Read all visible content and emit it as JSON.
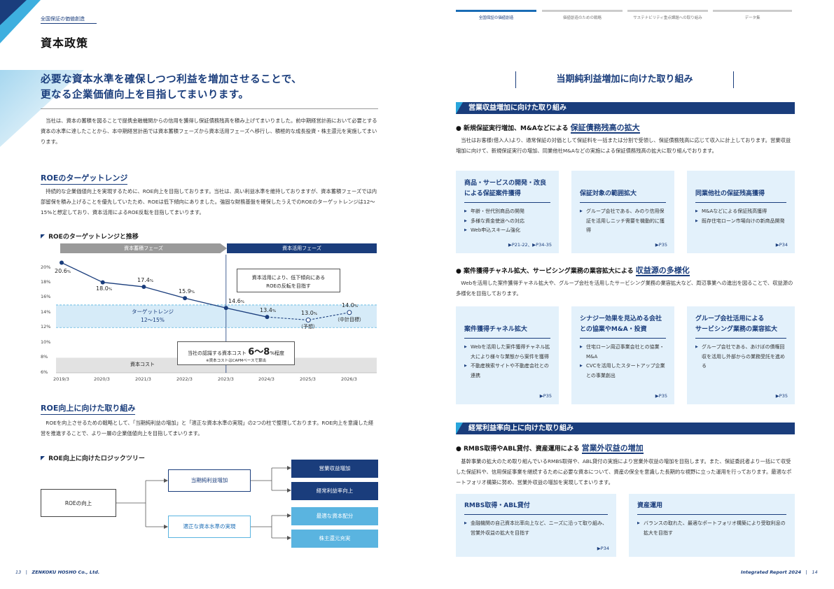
{
  "left": {
    "kicker": "全国保証の価値創造",
    "title": "資本政策",
    "lead_line1": "必要な資本水準を確保しつつ利益を増加させることで、",
    "lead_line2": "更なる企業価値向上を目指してまいります。",
    "intro": "当社は、資本の蓄積を図ることで提携金融機関からの信用を獲得し保証債務残高を積み上げてまいりました。前中期経営計画において必要とする資本の水準に達したことから、本中期経営計画では資本蓄積フェーズから資本活用フェーズへ移行し、積極的な成長投資・株主還元を実施してまいります。",
    "roe_section_title": "ROEのターゲットレンジ",
    "roe_section_text": "持続的な企業価値向上を実現するために、ROE向上を目指しております。当社は、高い利益水準を維持しておりますが、資本蓄積フェーズでは内部留保を積み上げることを優先していたため、ROEは低下傾向にありました。強固な財務基盤を確保したうえでのROEのターゲットレンジは12～15%と想定しており、資本活用によるROE反転を目指してまいります。",
    "chart_title": "ROEのターゲットレンジと推移",
    "improve_title": "ROE向上に向けた取り組み",
    "improve_text": "ROEを向上させるための戦略として、「当期純利益の増加」と「適正な資本水準の実現」の2つの柱で整理しております。ROE向上を意識した経営を推進することで、より一層の企業価値向上を目指してまいります。",
    "tree_title": "ROE向上に向けたロジックツリー",
    "tree": {
      "root": "ROEの向上",
      "branch1": "当期純利益増加",
      "branch2": "適正な資本水準の実現",
      "leaf1": "営業収益増加",
      "leaf2": "経常利益率向上",
      "leaf3": "最適な資本配分",
      "leaf4": "株主還元充実"
    },
    "footer_page": "13",
    "footer_brand": "ZENKOKU HOSHO Co., Ltd."
  },
  "chart_data": {
    "type": "line",
    "title": "ROEのターゲットレンジと推移",
    "categories": [
      "2019/3",
      "2020/3",
      "2021/3",
      "2022/3",
      "2023/3",
      "2024/3",
      "2025/3",
      "2026/3"
    ],
    "series": [
      {
        "values": [
          20.6,
          18.0,
          17.4,
          15.9,
          14.6,
          13.4,
          null,
          null
        ]
      },
      {
        "values": [
          null,
          null,
          null,
          null,
          null,
          13.4,
          13.0,
          14.0
        ]
      }
    ],
    "value_labels": [
      "20.6",
      "18.0",
      "17.4",
      "15.9",
      "14.6",
      "13.4",
      "13.0",
      "14.0"
    ],
    "unit": "%",
    "forecast_label": "（予想）",
    "target_label": "（中計目標）",
    "y_ticks": [
      "20%",
      "18%",
      "16%",
      "14%",
      "12%",
      "10%",
      "8%",
      "6%"
    ],
    "ylim": [
      6,
      20
    ],
    "phase1": "資本蓄積フェーズ",
    "phase2": "資本活用フェーズ",
    "target_range_label1": "ターゲットレンジ",
    "target_range_label2": "12～15%",
    "target_range": [
      12,
      15
    ],
    "cost_label": "資本コスト",
    "cost_range": [
      6,
      8
    ],
    "note_top1": "資本活用により、低下傾向にある",
    "note_top2": "ROEの反転を目指す",
    "note_cost_pre": "当社の認識する資本コスト",
    "note_cost_big": "6～8",
    "note_cost_post": "%程度",
    "note_cost_sub": "※資本コストはCAPMベースで算出"
  },
  "right": {
    "nav": [
      "全国保証の価値創造",
      "価値創造のための戦略",
      "サステナビリティ重点課題への取り組み",
      "データ集"
    ],
    "heading": "当期純利益増加に向けた取り組み",
    "band1": "営業収益増加に向けた取り組み",
    "b1_prefix": "新規保証実行増加、M&Aなどによる",
    "b1_hl": "保証債務残高の拡大",
    "b1_text": "当社はお客様(借入人)より、通常保証の対価として保証料を一括または分割で受領し、保証債務残高に応じて収入に計上しております。営業収益増加に向けて、新規保証実行の増加、同業他社M&Aなどの実施による保証債務残高の拡大に取り組んでおります。",
    "cards1": [
      {
        "h1": "商品・サービスの開発・改良",
        "h2": "による保証案件獲得",
        "items": [
          "年齢・世代別商品の開発",
          "多様な資金使途への対応",
          "Web申込スキーム強化"
        ],
        "ref": "▶P21-22、▶P34-35"
      },
      {
        "h1": "",
        "h2": "保証対象の範囲拡大",
        "items": [
          "グループ会社である、みのり信用保証を活用しニッチ需要を機動的に獲得"
        ],
        "ref": "▶P35"
      },
      {
        "h1": "",
        "h2": "同業他社の保証残高獲得",
        "items": [
          "M&Aなどによる保証残高獲得",
          "既存住宅ローン市場向けの新商品開発"
        ],
        "ref": "▶P34"
      }
    ],
    "b2_prefix": "案件獲得チャネル拡大、サービシング業務の業容拡大による",
    "b2_hl": "収益源の多様化",
    "b2_text": "Webを活用した案件獲得チャネル拡大や、グループ会社を活用したサービシング業務の業容拡大など、周辺事業への進出を図ることで、収益源の多様化を目指しております。",
    "cards2": [
      {
        "h1": "",
        "h2": "案件獲得チャネル拡大",
        "items": [
          "Webを活用した案件獲得チャネル拡大により様々な業態から案件を獲得",
          "不動産検索サイトや不動産会社との連携"
        ],
        "ref": "▶P35"
      },
      {
        "h1": "シナジー効果を見込める会社",
        "h2": "との協業やM&A・投資",
        "items": [
          "住宅ローン周辺事業会社との協業・M&A",
          "CVCを活用したスタートアップ企業との事業創出"
        ],
        "ref": "▶P35"
      },
      {
        "h1": "グループ会社活用による",
        "h2": "サービシング業務の業容拡大",
        "items": [
          "グループ会社である、あけぼの債権回収を活用し外部からの業務受託を進める"
        ],
        "ref": "▶P35"
      }
    ],
    "band2": "経常利益率向上に向けた取り組み",
    "b3_prefix": "RMBS取得やABL貸付、資産運用による",
    "b3_hl": "営業外収益の増加",
    "b3_text": "基幹事業の拡大のため取り組んでいるRMBS取得や、ABL貸付の実施により営業外収益の増加を目指します。また、保証委託者より一括にて収受した保証料や、信用保証事業を継続するために必要な資本について、資産の保全を意識した長期的な視野に立った運用を行っております。最適なポートフォリオ構築に努め、営業外収益の増加を実現してまいります。",
    "cards3": [
      {
        "h": "RMBS取得・ABL貸付",
        "items": [
          "金融機関の自己資本比率向上など、ニーズに沿って取り組み、営業外収益の拡大を目指す"
        ],
        "ref": "▶P34"
      },
      {
        "h": "資産運用",
        "items": [
          "バランスの取れた、最適なポートフォリオ構築により受取利息の拡大を目指す"
        ],
        "ref": ""
      }
    ],
    "footer_report": "Integrated Report 2024",
    "footer_page": "14"
  }
}
